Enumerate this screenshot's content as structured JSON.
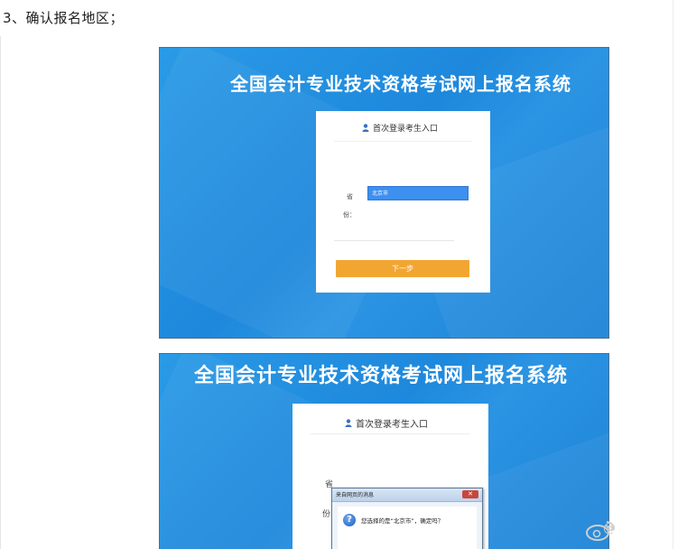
{
  "step": {
    "title": "3、确认报名地区；"
  },
  "screenshot1": {
    "system_title": "全国会计专业技术资格考试网上报名系统",
    "panel_header": "首次登录考生入口",
    "label_part1": "省",
    "label_part2": "份：",
    "selected_province": "北京市",
    "next_button": "下一步"
  },
  "screenshot2": {
    "system_title": "全国会计专业技术资格考试网上报名系统",
    "panel_header": "首次登录考生入口",
    "label_part1": "省",
    "label_part2": "份",
    "dialog": {
      "title": "来自网页的消息",
      "message": "您选择的是“北京市”，确定吗？",
      "icon": "question-icon"
    }
  },
  "watermark": {
    "icon": "weibo-logo",
    "text": "@"
  },
  "colors": {
    "banner_blue": "#1e88dc",
    "select_blue": "#3d8ff0",
    "button_orange": "#f2a632"
  }
}
